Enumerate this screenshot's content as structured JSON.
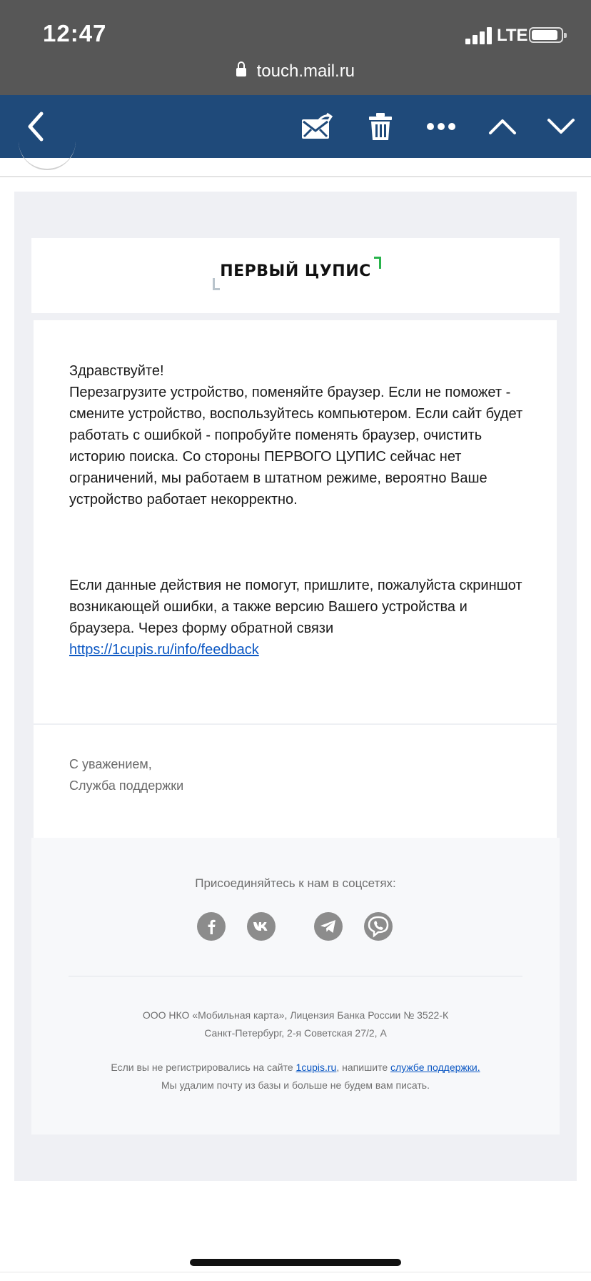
{
  "status_bar": {
    "time": "12:47",
    "carrier": "LTE",
    "url": "touch.mail.ru"
  },
  "toolbar": {
    "icons": [
      "back-icon",
      "mark-unread-icon",
      "trash-icon",
      "more-icon",
      "previous-icon",
      "next-icon"
    ],
    "color": "#1f4a7a"
  },
  "email": {
    "logo_text": "ПЕРВЫЙ ЦУПИС",
    "greeting": "Здравствуйте!",
    "body": "Перезагрузите устройство, поменяйте браузер. Если не поможет - смените устройство, воспользуйтесь компьютером. Если сайт будет работать с ошибкой - попробуйте поменять браузер, очистить историю поиска. Со стороны ПЕРВОГО ЦУПИС сейчас нет ограничений, мы работаем в штатном режиме, вероятно Ваше устройство работает некорректно.",
    "body2": "Если данные действия не помогут, пришлите, пожалуйста скриншот возникающей ошибки, а также версию Вашего устройства и браузера. Через форму обратной связи",
    "feedback_link": "https://1cupis.ru/info/feedback",
    "regards": "С уважением,",
    "signature": "Служба поддержки"
  },
  "footer": {
    "social_title": "Присоединяйтесь к нам в соцсетях:",
    "social_icons": [
      "facebook-icon",
      "vk-icon",
      "telegram-icon",
      "viber-icon"
    ],
    "legal_line1": "ООО НКО «Мобильная карта», Лицензия Банка России № 3522-К",
    "legal_line2": "Санкт-Петербург, 2-я Советская 27/2, А",
    "unsub_prefix": "Если вы не регистрировались на сайте",
    "unsub_site_link": "1cupis.ru",
    "unsub_middle": ", напишите",
    "unsub_support_link": "службе поддержки.",
    "unsub_line2": "Мы удалим почту из базы и больше не будем вам писать."
  },
  "colors": {
    "link": "#0b57c3",
    "logo_accent": "#28b34b"
  }
}
